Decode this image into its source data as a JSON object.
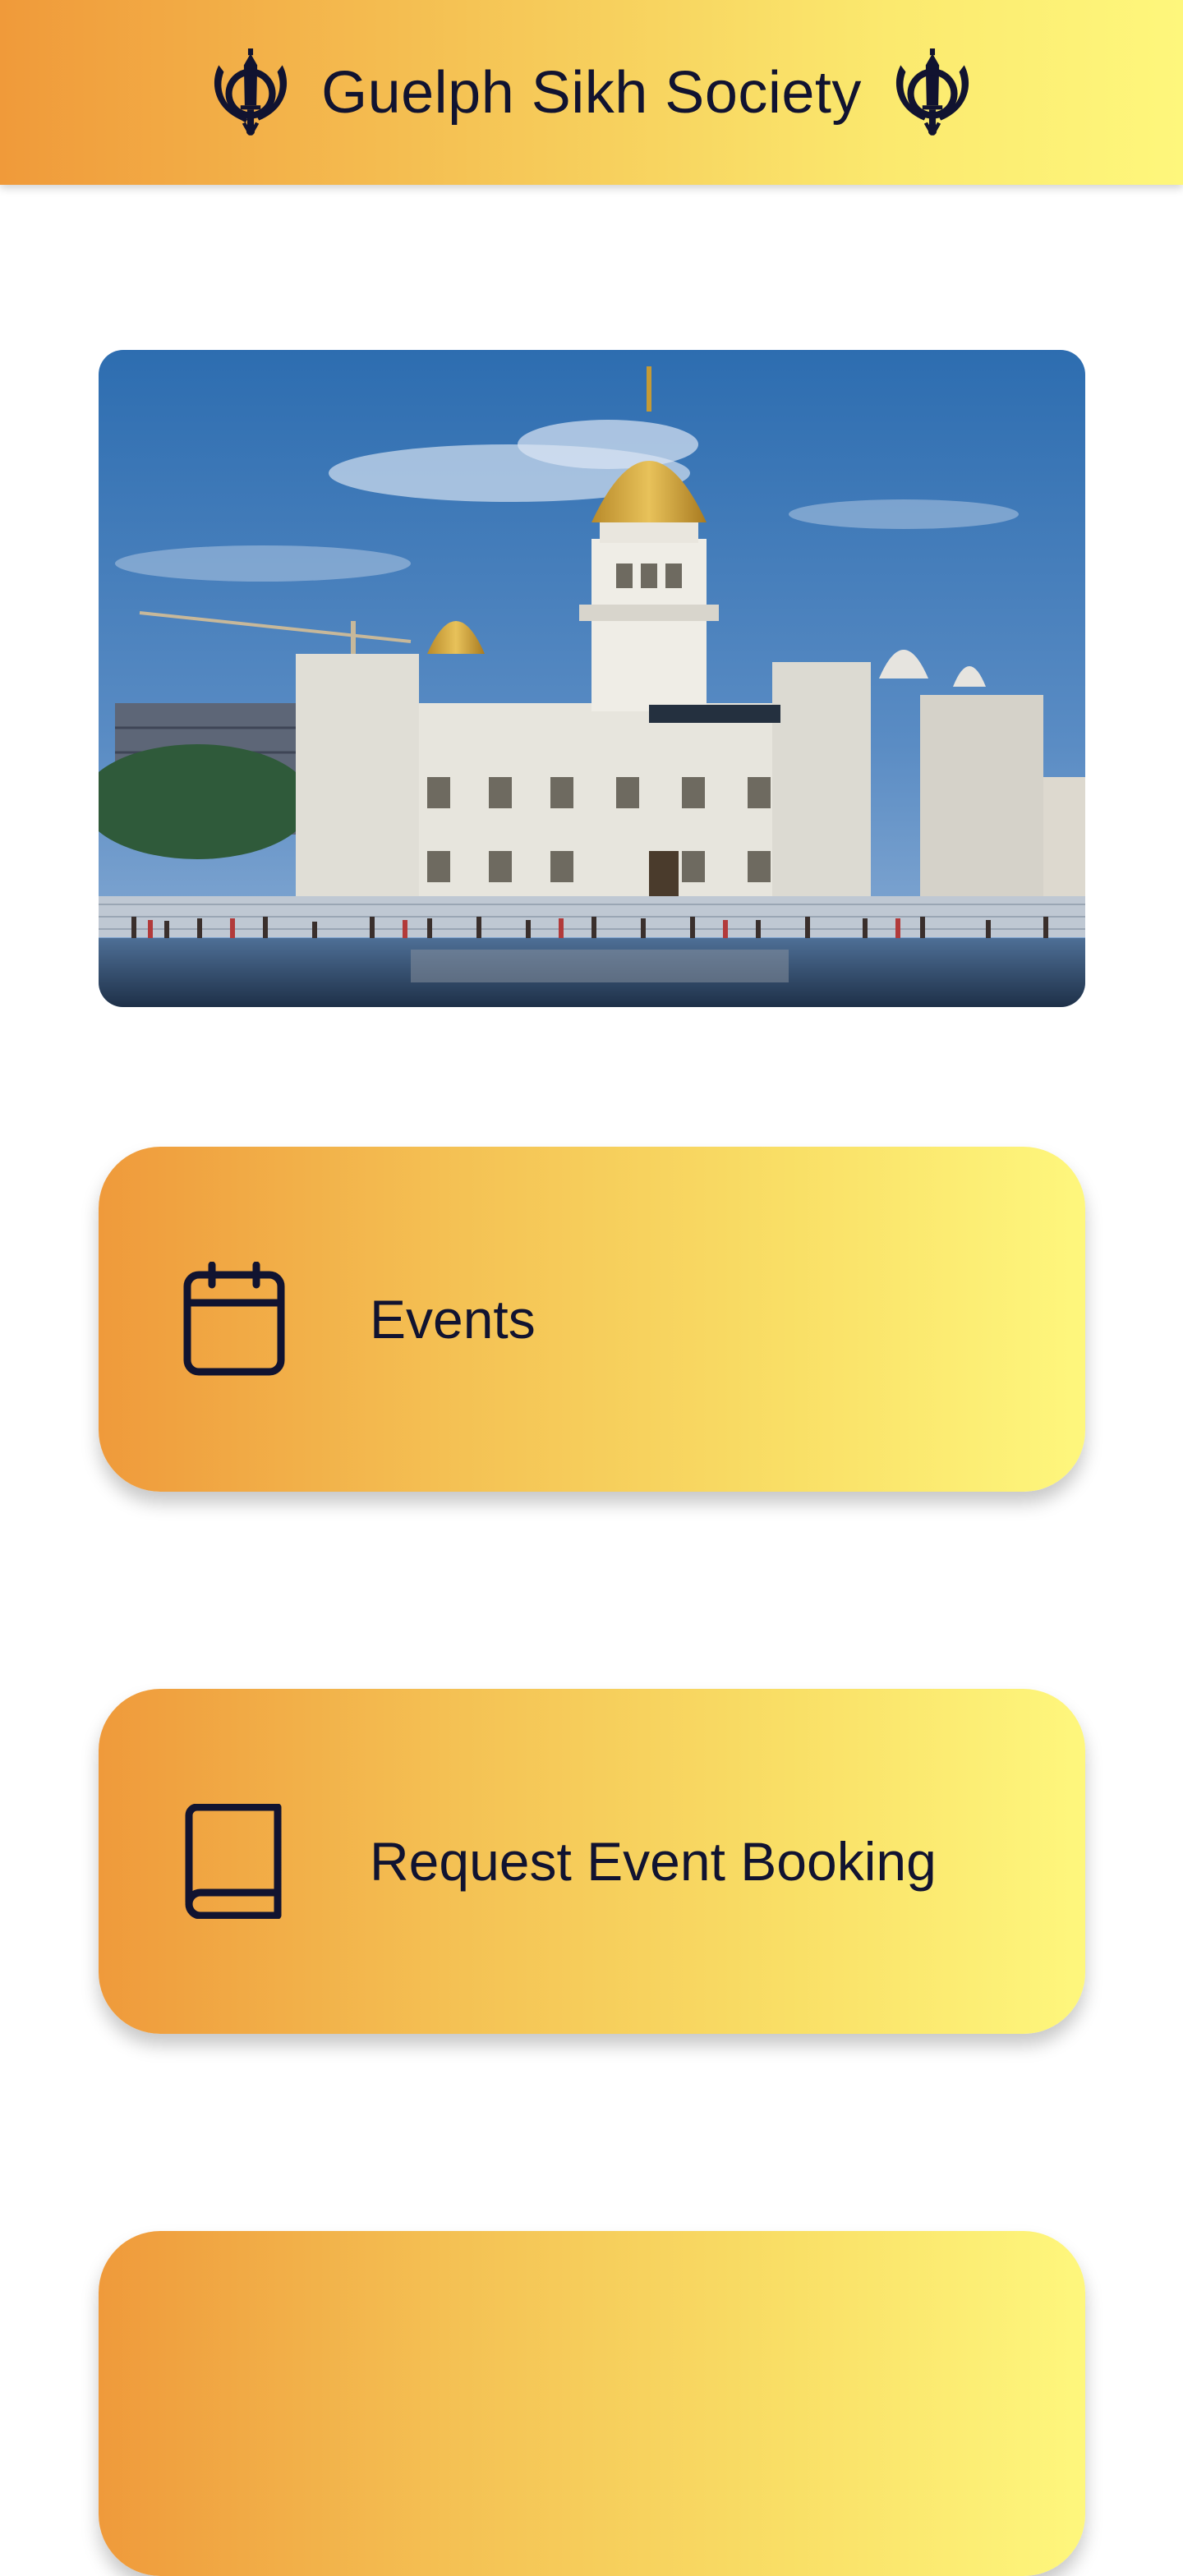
{
  "header": {
    "title": "Guelph Sikh Society",
    "left_icon": "khanda-icon",
    "right_icon": "khanda-icon"
  },
  "hero": {
    "image": "gurdwara-photo"
  },
  "menu": {
    "items": [
      {
        "label": "Events",
        "icon": "calendar-icon"
      },
      {
        "label": "Request Event Booking",
        "icon": "book-icon"
      },
      {
        "label": "",
        "icon": ""
      }
    ]
  },
  "colors": {
    "gradient_start": "#ef9a3b",
    "gradient_end": "#fef77d",
    "text": "#111330"
  }
}
